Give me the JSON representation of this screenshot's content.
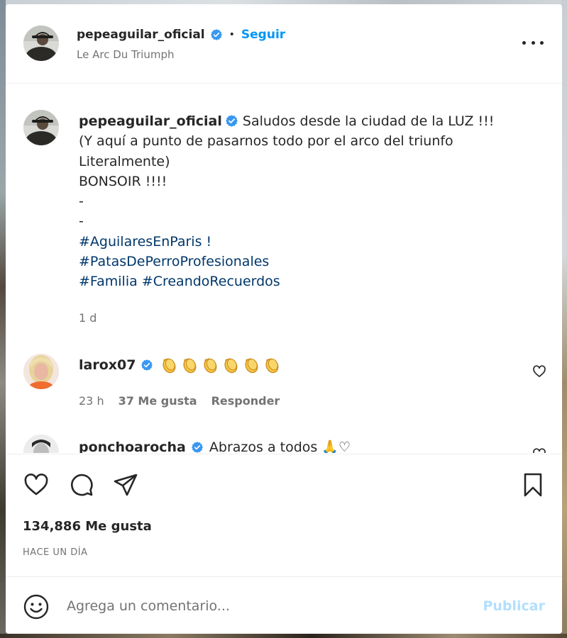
{
  "post": {
    "username": "pepeaguilar_oficial",
    "follow_label": "Seguir",
    "dot": "•",
    "location": "Le Arc Du Triumph"
  },
  "caption": {
    "username": "pepeaguilar_oficial",
    "lines": [
      "Saludos desde la ciudad de la LUZ !!!",
      "(Y aquí a punto de pasarnos todo por el arco del triunfo",
      "Literalmente)",
      "BONSOIR !!!!",
      "-",
      "-"
    ],
    "hashtags": [
      "#AguilaresEnParis !",
      "#PatasDePerroProfesionales",
      "#Familia #CreandoRecuerdos"
    ],
    "time": "1 d"
  },
  "comments": [
    {
      "username": "larox07",
      "emoji": [
        "clap-icon",
        "clap-icon",
        "clap-icon",
        "clap-icon",
        "clap-icon",
        "clap-icon"
      ],
      "time": "23 h",
      "likes": "37 Me gusta",
      "reply_label": "Responder"
    },
    {
      "username": "ponchoarocha",
      "text": "Abrazos a todos 🙏♡"
    }
  ],
  "footer": {
    "likes": "134,886 Me gusta",
    "time_ago": "HACE UN DÍA",
    "comment_placeholder": "Agrega un comentario...",
    "publish_label": "Publicar"
  },
  "colors": {
    "accent": "#0095f6",
    "publish_disabled": "#b2dffc",
    "verified": "#3897f0",
    "hashtag": "#00376b",
    "secondary_text": "#737373"
  }
}
